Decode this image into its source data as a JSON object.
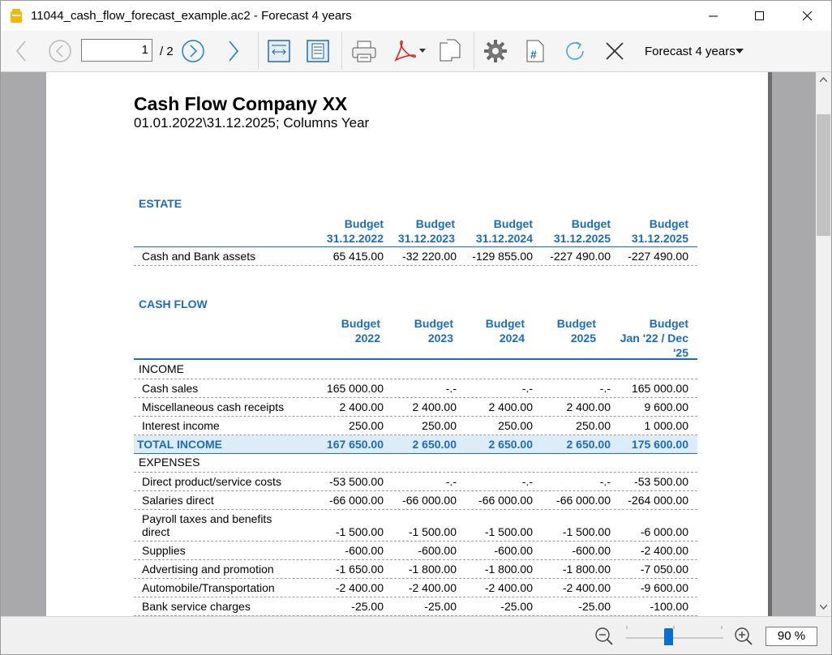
{
  "window": {
    "title": "11044_cash_flow_forecast_example.ac2 - Forecast 4 years"
  },
  "toolbar": {
    "page_current": "1",
    "page_total": "/ 2",
    "layout_label": "Forecast 4 years",
    "icons": [
      "arrow-back-icon",
      "prev-page-icon",
      "next-page-icon",
      "arrow-forward-icon",
      "fit-width-icon",
      "fit-page-icon",
      "print-icon",
      "pdf-icon",
      "copy-icon",
      "settings-icon",
      "page-number-icon",
      "refresh-icon",
      "close-report-icon"
    ]
  },
  "status": {
    "zoom": "90 %",
    "zoom_level_percent": 90
  },
  "report": {
    "title": "Cash Flow Company XX",
    "subtitle": "01.01.2022\\31.12.2025; Columns Year",
    "estate": {
      "heading": "ESTATE",
      "columns": [
        {
          "l1": "Budget",
          "l2": "31.12.2022"
        },
        {
          "l1": "Budget",
          "l2": "31.12.2023"
        },
        {
          "l1": "Budget",
          "l2": "31.12.2024"
        },
        {
          "l1": "Budget",
          "l2": "31.12.2025"
        },
        {
          "l1": "Budget",
          "l2": "31.12.2025"
        }
      ],
      "rows": [
        {
          "label": "Cash and Bank assets",
          "values": [
            "65 415.00",
            "-32 220.00",
            "-129 855.00",
            "-227 490.00",
            "-227 490.00"
          ]
        }
      ]
    },
    "cashflow": {
      "heading": "CASH FLOW",
      "columns": [
        {
          "l1": "Budget",
          "l2": "2022",
          "l3": ""
        },
        {
          "l1": "Budget",
          "l2": "2023",
          "l3": ""
        },
        {
          "l1": "Budget",
          "l2": "2024",
          "l3": ""
        },
        {
          "l1": "Budget",
          "l2": "2025",
          "l3": ""
        },
        {
          "l1": "Budget",
          "l2": "Jan '22 / Dec",
          "l3": "'25"
        }
      ],
      "income_group": "INCOME",
      "income_rows": [
        {
          "label": "Cash sales",
          "values": [
            "165 000.00",
            "-.-",
            "-.-",
            "-.-",
            "165 000.00"
          ]
        },
        {
          "label": "Miscellaneous cash receipts",
          "values": [
            "2 400.00",
            "2 400.00",
            "2 400.00",
            "2 400.00",
            "9 600.00"
          ]
        },
        {
          "label": "Interest income",
          "values": [
            "250.00",
            "250.00",
            "250.00",
            "250.00",
            "1 000.00"
          ]
        }
      ],
      "total_income": {
        "label": "TOTAL INCOME",
        "values": [
          "167 650.00",
          "2 650.00",
          "2 650.00",
          "2 650.00",
          "175 600.00"
        ]
      },
      "expenses_group": "EXPENSES",
      "expense_rows": [
        {
          "label": "Direct product/service costs",
          "values": [
            "-53 500.00",
            "-.-",
            "-.-",
            "-.-",
            "-53 500.00"
          ]
        },
        {
          "label": "Salaries direct",
          "values": [
            "-66 000.00",
            "-66 000.00",
            "-66 000.00",
            "-66 000.00",
            "-264 000.00"
          ]
        },
        {
          "label": "Payroll taxes and benefits",
          "label2": "direct",
          "values": [
            "-1 500.00",
            "-1 500.00",
            "-1 500.00",
            "-1 500.00",
            "-6 000.00"
          ]
        },
        {
          "label": "Supplies",
          "values": [
            "-600.00",
            "-600.00",
            "-600.00",
            "-600.00",
            "-2 400.00"
          ]
        },
        {
          "label": "Advertising and promotion",
          "values": [
            "-1 650.00",
            "-1 800.00",
            "-1 800.00",
            "-1 800.00",
            "-7 050.00"
          ]
        },
        {
          "label": "Automobile/Transportation",
          "values": [
            "-2 400.00",
            "-2 400.00",
            "-2 400.00",
            "-2 400.00",
            "-9 600.00"
          ]
        },
        {
          "label": "Bank service charges",
          "values": [
            "-25.00",
            "-25.00",
            "-25.00",
            "-25.00",
            "-100.00"
          ]
        }
      ]
    }
  }
}
